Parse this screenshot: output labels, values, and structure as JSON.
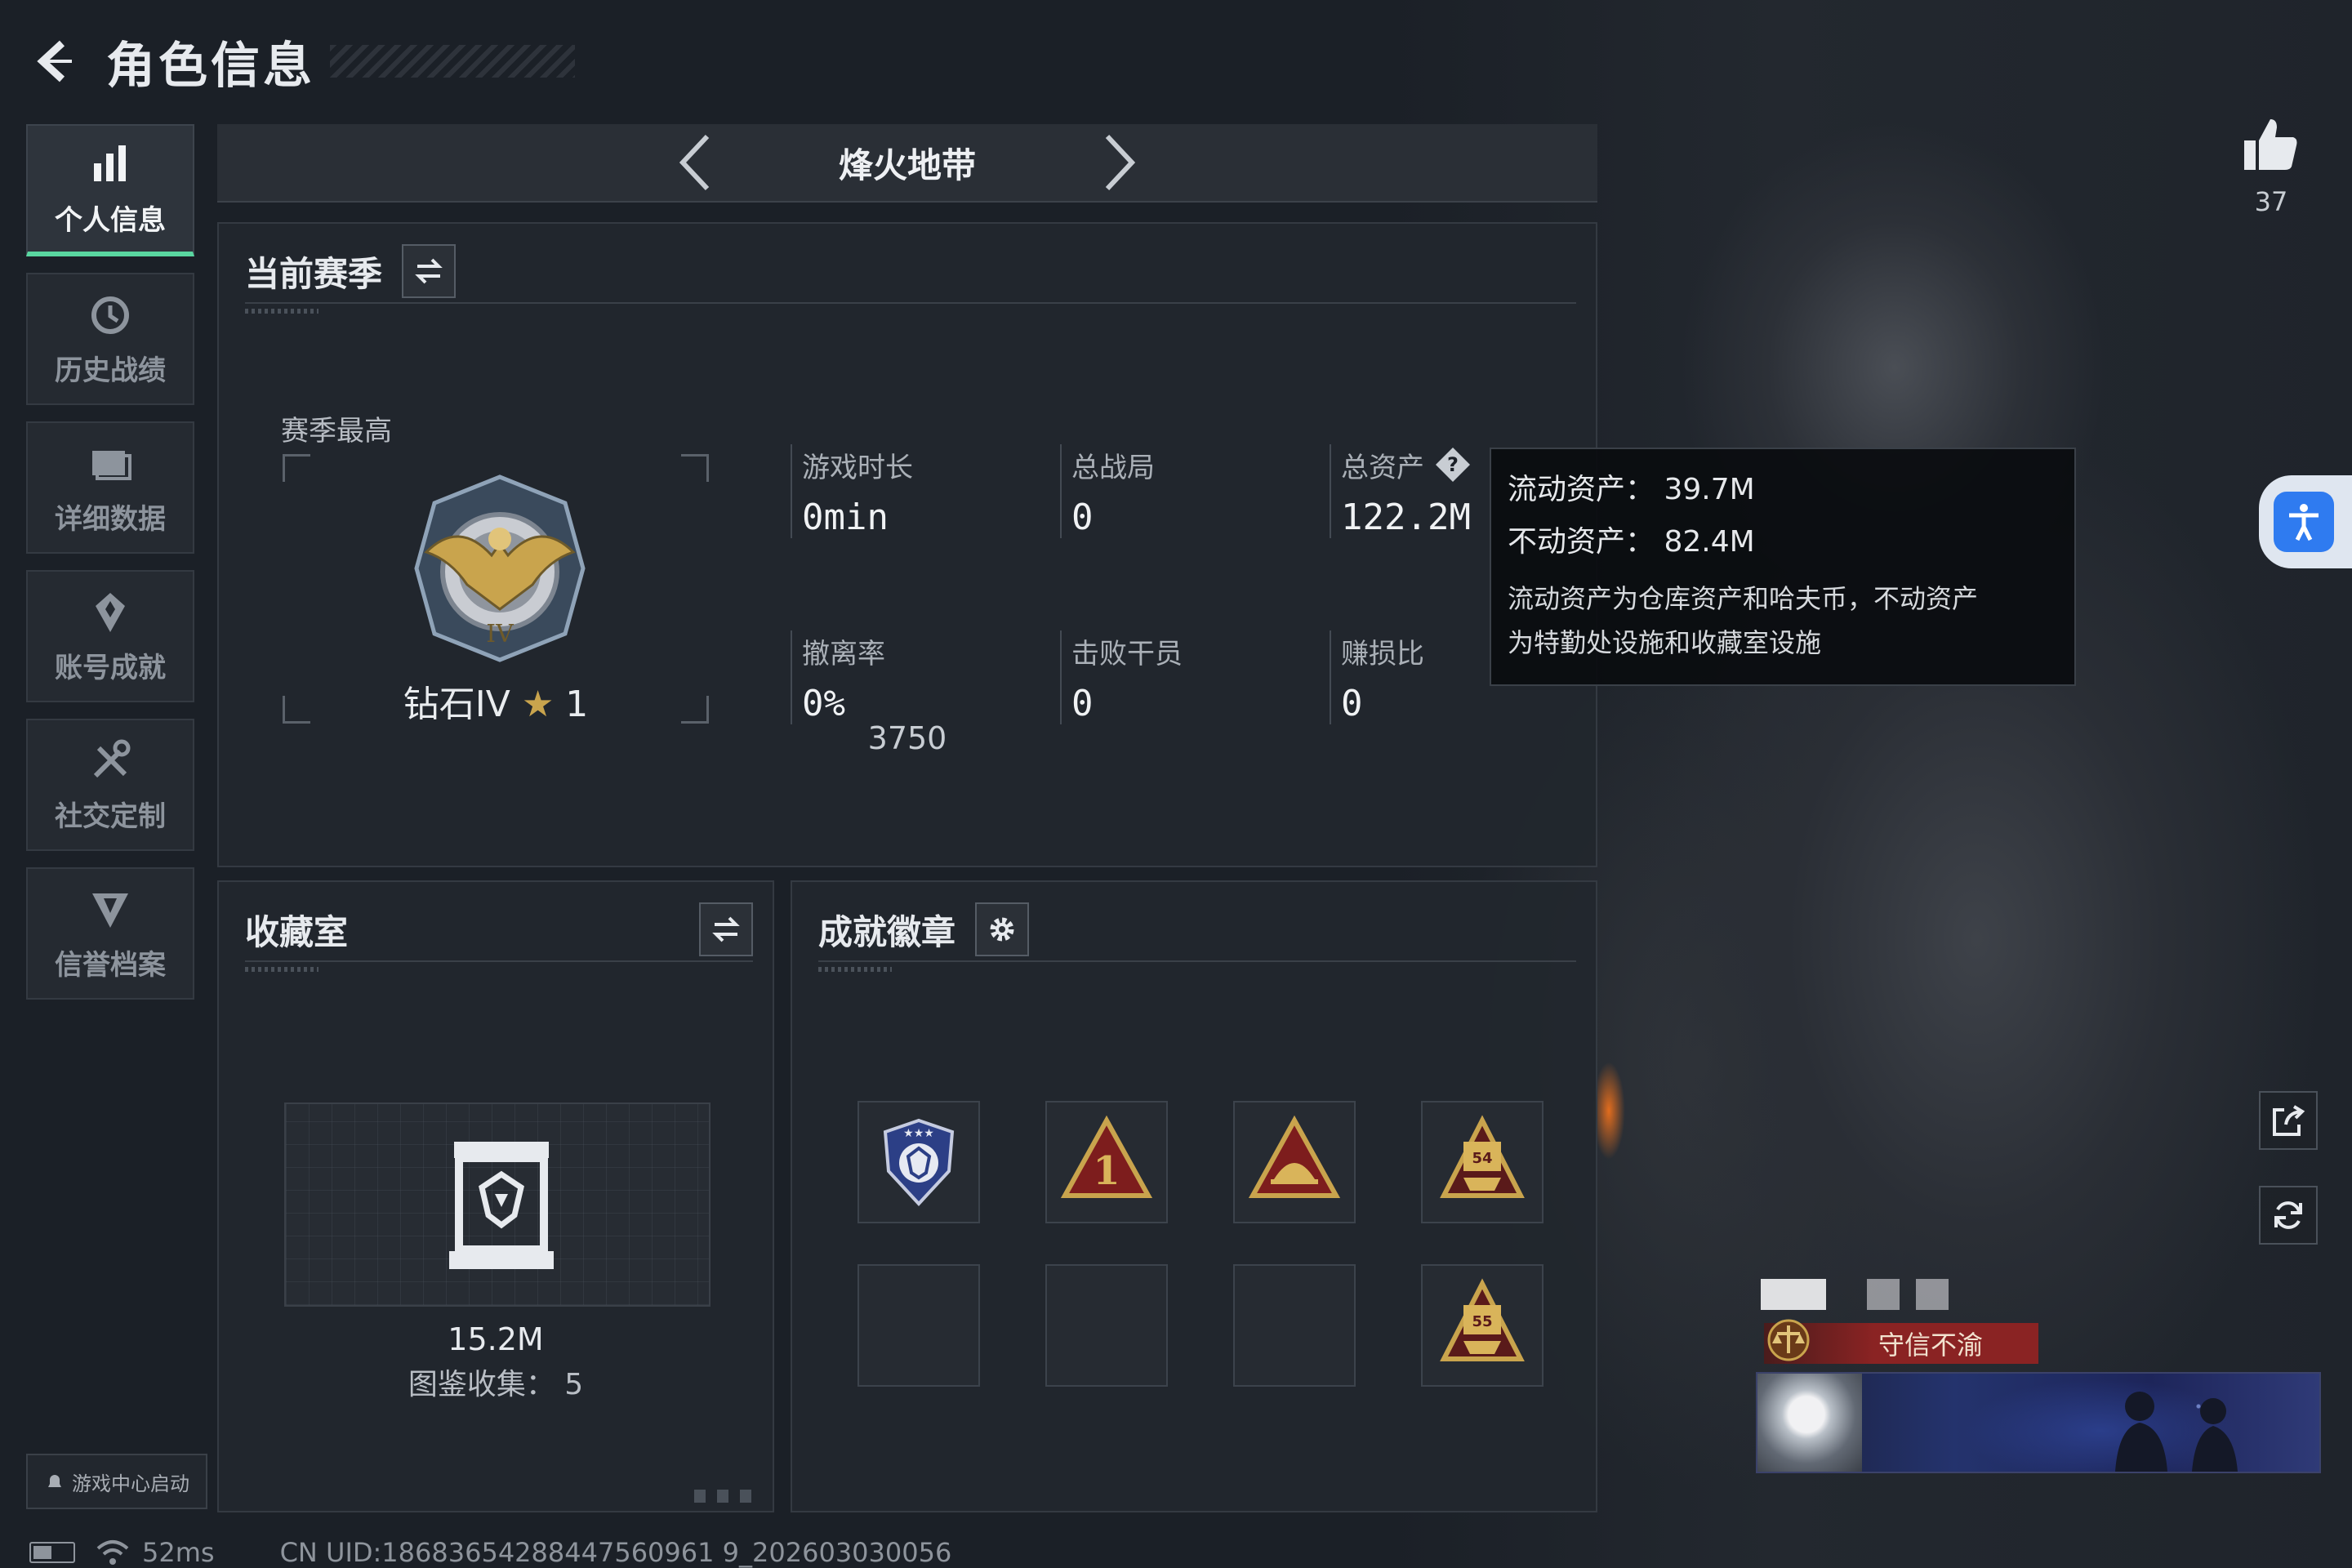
{
  "header": {
    "title": "角色信息"
  },
  "sidebar": {
    "items": [
      {
        "label": "个人信息",
        "icon": "bar-chart-icon",
        "active": true
      },
      {
        "label": "历史战绩",
        "icon": "history-clock-icon",
        "active": false
      },
      {
        "label": "详细数据",
        "icon": "folder-icon",
        "active": false
      },
      {
        "label": "账号成就",
        "icon": "achievement-icon",
        "active": false
      },
      {
        "label": "社交定制",
        "icon": "tools-icon",
        "active": false
      },
      {
        "label": "信誉档案",
        "icon": "credit-shield-icon",
        "active": false
      }
    ],
    "game_center_label": "游戏中心启动"
  },
  "mode_bar": {
    "mode_name": "烽火地带"
  },
  "season": {
    "title": "当前赛季",
    "best_label": "赛季最高",
    "rank_name": "钻石IV",
    "rank_stars": "1",
    "rank_points": "3750",
    "stats": [
      {
        "label": "游戏时长",
        "value": "0min"
      },
      {
        "label": "总战局",
        "value": "0"
      },
      {
        "label": "总资产",
        "value": "122.2M"
      },
      {
        "label": "撤离率",
        "value": "0%"
      },
      {
        "label": "击败干员",
        "value": "0"
      },
      {
        "label": "赚损比",
        "value": "0"
      }
    ]
  },
  "tooltip": {
    "liquid": "流动资产：  39.7M",
    "fixed": "不动资产：  82.4M",
    "desc_line1": "流动资产为仓库资产和哈夫币，不动资产",
    "desc_line2": "为特勤处设施和收藏室设施"
  },
  "collection": {
    "title": "收藏室",
    "value": "15.2M",
    "count_label": "图鉴收集：  5"
  },
  "badges": {
    "title": "成就徽章",
    "slots": [
      {
        "icon": "blue-shield-badge-icon",
        "filled": true
      },
      {
        "icon": "rank-one-badge-icon",
        "filled": true
      },
      {
        "icon": "cap-triangle-badge-icon",
        "filled": true
      },
      {
        "icon": "level-54-badge-icon",
        "filled": true
      },
      {
        "icon": "",
        "filled": false
      },
      {
        "icon": "",
        "filled": false
      },
      {
        "icon": "",
        "filled": false
      },
      {
        "icon": "level-55-badge-icon",
        "filled": true
      }
    ]
  },
  "profile": {
    "likes": "37",
    "credit_title": "守信不渝"
  },
  "status_bar": {
    "ping": "52ms",
    "uid": "CN UID:18683654288447560961 9_202603030056"
  },
  "colors": {
    "accent_green": "#59d6a0",
    "gold": "#c9a44d",
    "credit_red": "#8a2323",
    "access_blue": "#2f7bf0"
  }
}
